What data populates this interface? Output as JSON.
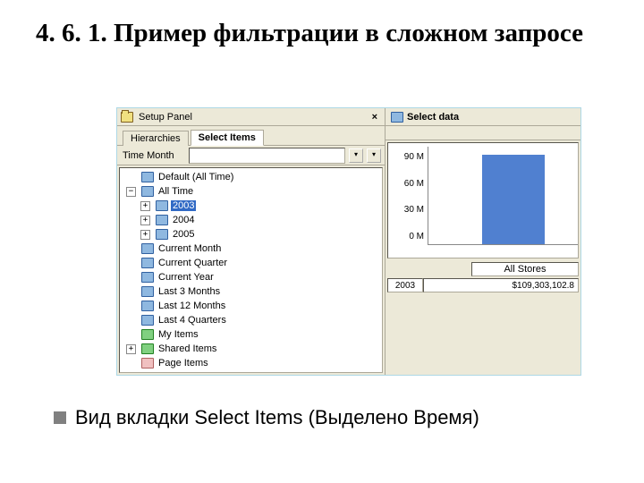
{
  "slide": {
    "title": "4. 6. 1. Пример фильтрации в сложном запросе",
    "bullet": "Вид вкладки Select Items (Выделено Время)"
  },
  "panel": {
    "setup_label": "Setup Panel",
    "tabs": {
      "hierarchies": "Hierarchies",
      "select_items": "Select Items"
    },
    "field_label": "Time Month"
  },
  "tree": {
    "root": "Default (All Time)",
    "all_time": "All Time",
    "years": [
      "2003",
      "2004",
      "2005"
    ],
    "relative": [
      "Current Month",
      "Current Quarter",
      "Current Year",
      "Last 3 Months",
      "Last 12 Months",
      "Last 4 Quarters"
    ],
    "my_items": "My Items",
    "shared_items": "Shared Items",
    "page_items": "Page Items"
  },
  "right": {
    "header": "Select data",
    "legend_all": "All Stores",
    "row_year": "2003",
    "row_value": "$109,303,102.8"
  },
  "chart_data": {
    "type": "bar",
    "categories": [
      "2003"
    ],
    "values": [
      109303102
    ],
    "ylabels": [
      "90 M",
      "60 M",
      "30 M",
      "0 M"
    ],
    "ylim": [
      0,
      120000000
    ]
  }
}
